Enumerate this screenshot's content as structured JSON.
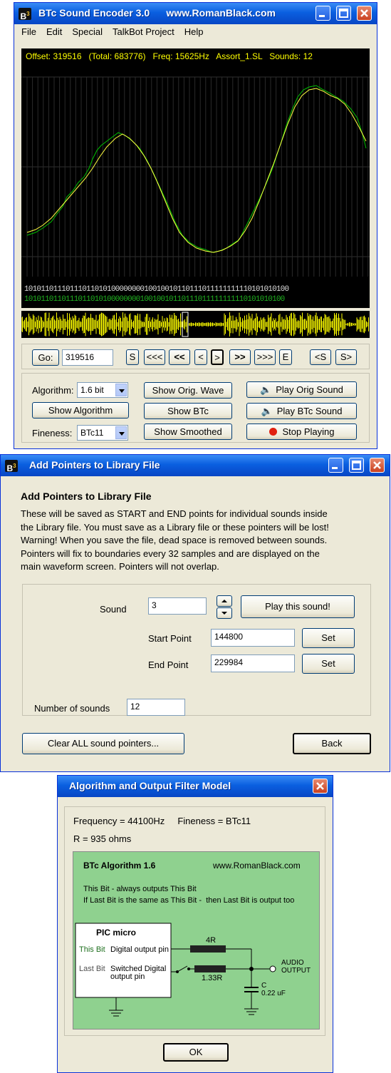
{
  "main": {
    "title": "BTc Sound Encoder 3.0      www.RomanBlack.com",
    "menu": [
      "File",
      "Edit",
      "Special",
      "TalkBot Project",
      "Help"
    ],
    "info_line": "Offset: 319516   (Total: 683776)   Freq: 15625Hz   Assort_1.SL   Sounds: 12",
    "bits_top": "1010110111011101101010000000010010010110111011111111110101010100",
    "bits_bottom": "101011011011101101010000000010010010110111011111111110101010100",
    "go_label": "Go:",
    "go_value": "319516",
    "nav_buttons": [
      "S",
      "<<<",
      "<<",
      "<",
      ">",
      ">>",
      ">>>",
      "E",
      "<S",
      "S>"
    ],
    "algorithm_label": "Algorithm:",
    "algorithm_value": "1.6 bit",
    "show_algorithm": "Show Algorithm",
    "fineness_label": "Fineness:",
    "fineness_value": "BTc11",
    "show_orig_wave": "Show Orig. Wave",
    "show_btc": "Show BTc",
    "show_smoothed": "Show Smoothed",
    "play_orig": "Play Orig Sound",
    "play_btc": "Play BTc Sound",
    "stop_playing": "Stop Playing"
  },
  "pointers": {
    "title": "Add Pointers to Library File",
    "heading": "Add Pointers to Library File",
    "desc": [
      "These will be saved as START and END points for individual sounds inside",
      "the Library file. You must save as a Library file or these pointers will be lost!",
      "Warning! When you save the file, dead space is removed between sounds.",
      "Pointers will fix to boundaries every 32 samples and are displayed on the",
      "main waveform screen. Pointers will not overlap."
    ],
    "sound_label": "Sound",
    "sound_value": "3",
    "play_this": "Play this sound!",
    "start_label": "Start Point",
    "start_value": "144800",
    "set1": "Set",
    "end_label": "End Point",
    "end_value": "229984",
    "set2": "Set",
    "num_label": "Number of sounds",
    "num_value": "12",
    "clear_all": "Clear ALL sound pointers...",
    "back": "Back"
  },
  "algo": {
    "title": "Algorithm and Output Filter Model",
    "freq_line": "Frequency = 44100Hz     Fineness = BTc11",
    "r_line": "R = 935 ohms",
    "d_title": "BTc Algorithm 1.6",
    "d_site": "www.RomanBlack.com",
    "d_line1": "This Bit - always outputs This Bit",
    "d_line2": "If Last Bit is the same as This Bit -  then Last Bit is output too",
    "pic": "PIC micro",
    "this_bit": "This Bit",
    "digital_out": "Digital output pin",
    "last_bit": "Last Bit",
    "switched1": "Switched Digital",
    "switched2": "output pin",
    "r4": "4R",
    "r133": "1.33R",
    "audio": "AUDIO",
    "output": "OUTPUT",
    "c": "C",
    "cval": "0.22 uF",
    "ok": "OK"
  },
  "colors": {
    "accent": "#0a5fe0",
    "green_text": "#20b020",
    "yellow": "#ffff00"
  }
}
